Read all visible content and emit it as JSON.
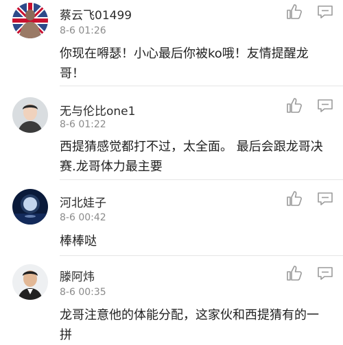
{
  "comments": [
    {
      "username": "蔡云飞01499",
      "time": "8-6 01:26",
      "text": "你现在嘚瑟！小心最后你被ko哦！友情提醒龙哥！",
      "avatar_icon": "avatar-shirtless-man-flag",
      "like_icon": "thumbs-up-icon",
      "reply_icon": "comment-bubble-icon"
    },
    {
      "username": "无与伦比one1",
      "time": "8-6 01:22",
      "text": "西提猜感觉都打不过，太全面。 最后会跟龙哥决赛.龙哥体力最主要",
      "avatar_icon": "avatar-young-man",
      "like_icon": "thumbs-up-icon",
      "reply_icon": "comment-bubble-icon"
    },
    {
      "username": "河北娃子",
      "time": "8-6 00:42",
      "text": "棒棒哒",
      "avatar_icon": "avatar-moon-night",
      "like_icon": "thumbs-up-icon",
      "reply_icon": "comment-bubble-icon"
    },
    {
      "username": "滕阿炜",
      "time": "8-6 00:35",
      "text": "龙哥注意他的体能分配，这家伙和西提猜有的一拼",
      "avatar_icon": "avatar-man-portrait",
      "like_icon": "thumbs-up-icon",
      "reply_icon": "comment-bubble-icon"
    }
  ],
  "colors": {
    "username": "#2b2b2b",
    "time": "#8a8a8a",
    "text": "#1f1f1f",
    "icon": "#9a9a9a",
    "divider": "#e5e5e5"
  }
}
